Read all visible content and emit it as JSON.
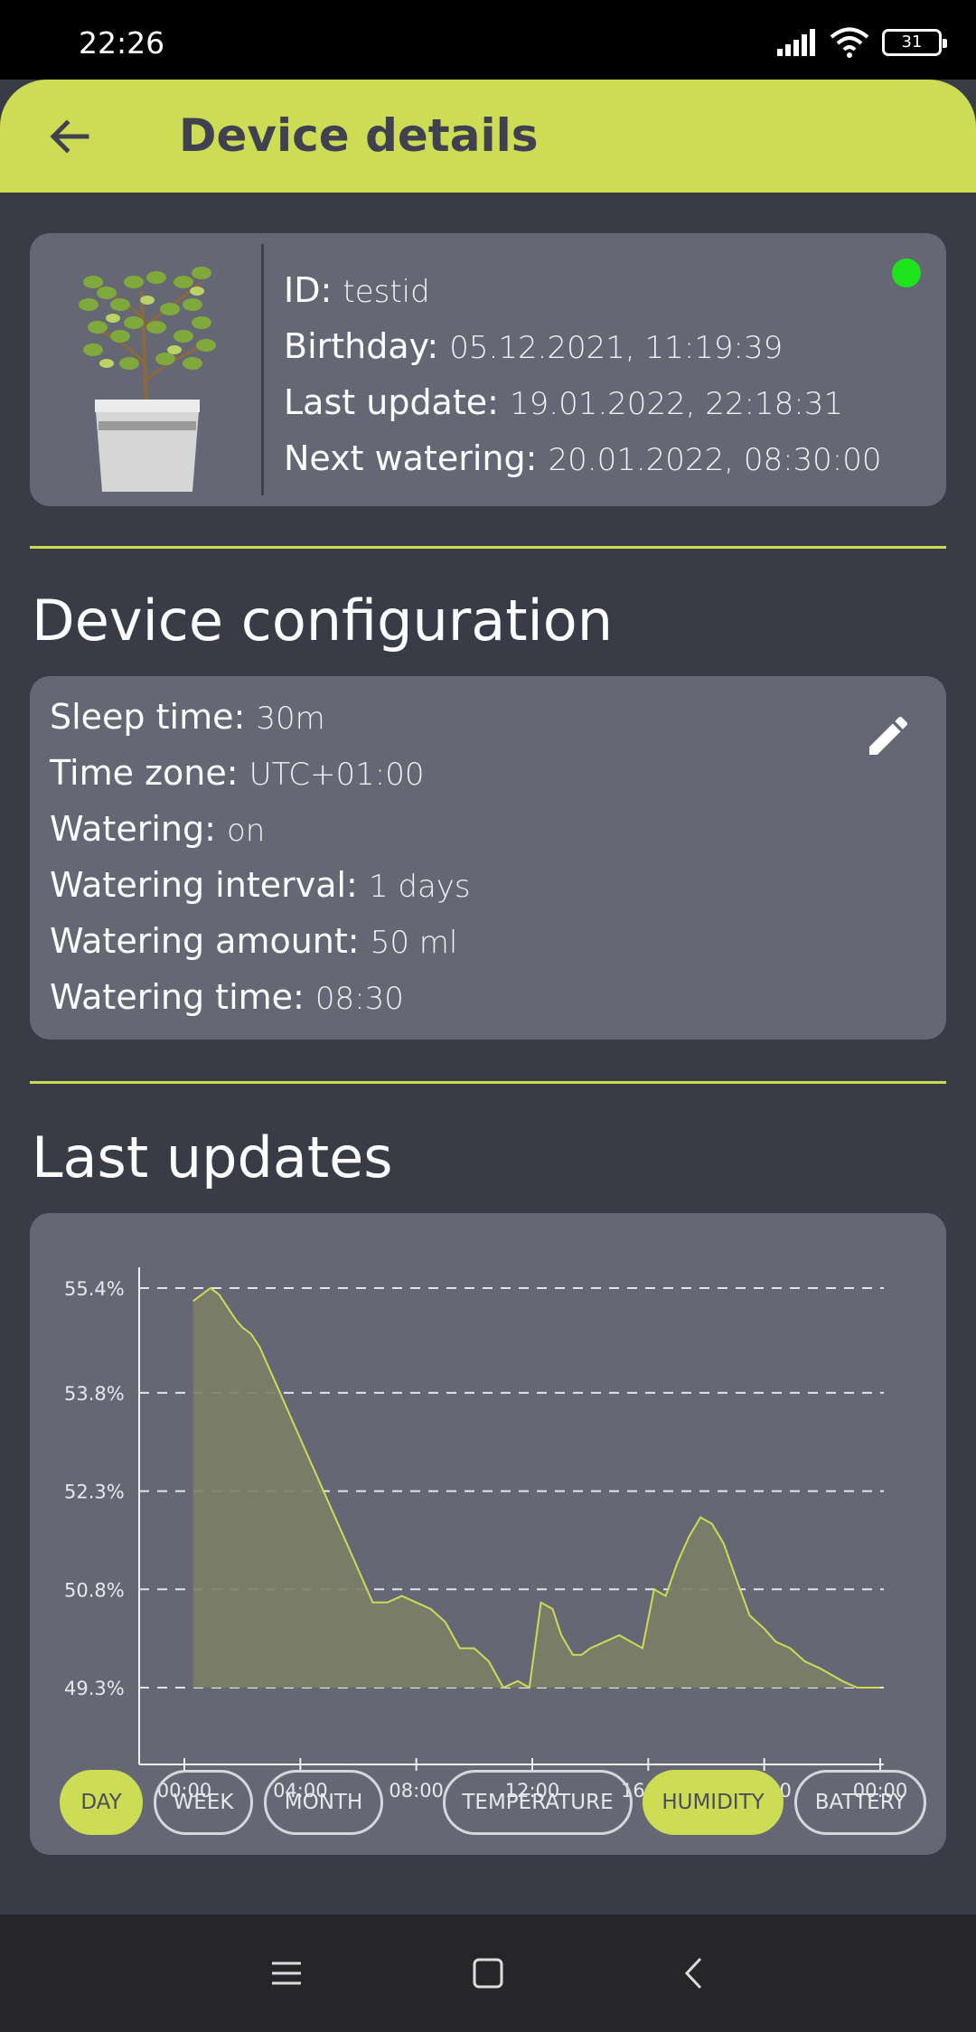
{
  "status_bar": {
    "time": "22:26",
    "battery": "31"
  },
  "app_bar": {
    "title": "Device details"
  },
  "device": {
    "online_color": "#1de41d",
    "rows": [
      {
        "label": "ID:",
        "value": "testid"
      },
      {
        "label": "Birthday:",
        "value": "05.12.2021, 11:19:39"
      },
      {
        "label": "Last update:",
        "value": "19.01.2022, 22:18:31"
      },
      {
        "label": "Next watering:",
        "value": "20.01.2022, 08:30:00"
      }
    ]
  },
  "configuration": {
    "title": "Device configuration",
    "rows": [
      {
        "label": "Sleep time:",
        "value": "30m"
      },
      {
        "label": "Time zone:",
        "value": "UTC+01:00"
      },
      {
        "label": "Watering:",
        "value": "on"
      },
      {
        "label": "Watering interval:",
        "value": "1 days"
      },
      {
        "label": "Watering amount:",
        "value": "50 ml"
      },
      {
        "label": "Watering time:",
        "value": "08:30"
      }
    ]
  },
  "updates": {
    "title": "Last updates",
    "range_buttons": [
      "DAY",
      "WEEK",
      "MONTH"
    ],
    "range_selected": "DAY",
    "metric_buttons": [
      "TEMPERATURE",
      "HUMIDITY",
      "BATTERY"
    ],
    "metric_selected": "HUMIDITY"
  },
  "chart_data": {
    "type": "area",
    "title": "",
    "xlabel": "",
    "ylabel": "",
    "x_ticks": [
      "00:00",
      "04:00",
      "08:00",
      "12:00",
      "16:00",
      "20:00",
      "00:00"
    ],
    "y_ticks": [
      "49.3%",
      "50.8%",
      "52.3%",
      "53.8%",
      "55.4%"
    ],
    "xlim": [
      0,
      24
    ],
    "ylim": [
      49.3,
      55.4
    ],
    "grid": true,
    "line_color": "#cddc55",
    "fill_color": "#7b7f67",
    "series": [
      {
        "x": [
          0.3,
          0.6,
          0.9,
          1.2,
          1.5,
          1.8,
          2.0,
          2.3,
          2.6,
          2.9,
          3.2,
          3.5,
          3.8,
          4.1,
          4.5,
          5.0,
          5.5,
          6.0,
          6.5,
          7.0,
          7.5,
          8.0,
          8.5,
          9.0,
          9.5,
          10.0,
          10.5,
          11.0,
          11.5,
          11.9,
          12.3,
          12.7,
          13.0,
          13.4,
          13.7,
          14.0,
          14.5,
          15.0,
          15.4,
          15.8,
          16.2,
          16.6,
          17.0,
          17.4,
          17.8,
          18.2,
          18.6,
          19.0,
          19.5,
          20.0,
          20.4,
          20.9,
          21.4,
          21.9,
          22.3,
          22.7,
          23.2,
          23.7,
          24.0
        ],
        "y": [
          55.2,
          55.3,
          55.4,
          55.3,
          55.1,
          54.9,
          54.8,
          54.7,
          54.5,
          54.2,
          53.9,
          53.6,
          53.3,
          53.0,
          52.6,
          52.1,
          51.6,
          51.1,
          50.6,
          50.6,
          50.7,
          50.6,
          50.5,
          50.3,
          49.9,
          49.9,
          49.7,
          49.3,
          49.4,
          49.3,
          50.6,
          50.5,
          50.1,
          49.8,
          49.8,
          49.9,
          50.0,
          50.1,
          50.0,
          49.9,
          50.8,
          50.7,
          51.2,
          51.6,
          51.9,
          51.8,
          51.5,
          51.0,
          50.4,
          50.2,
          50.0,
          49.9,
          49.7,
          49.6,
          49.5,
          49.4,
          49.3,
          49.3,
          49.3
        ]
      }
    ]
  }
}
